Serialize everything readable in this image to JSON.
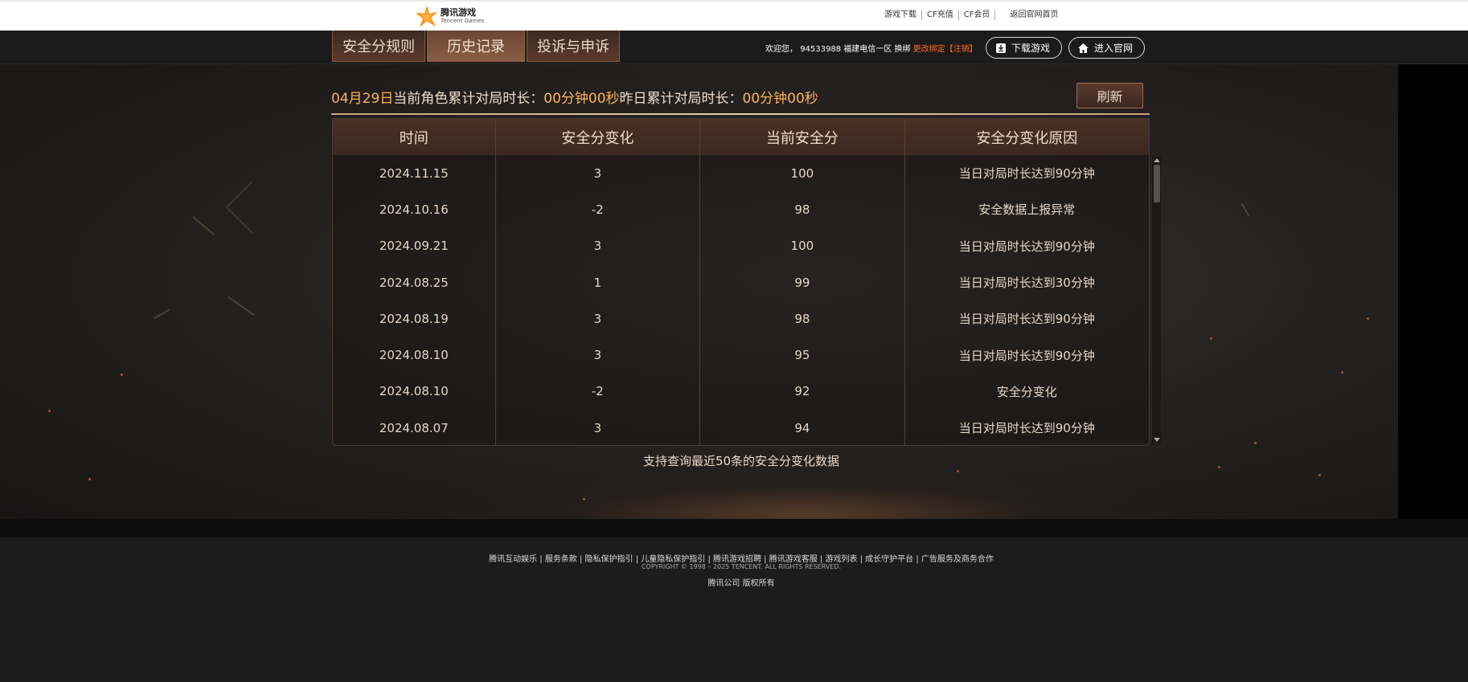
{
  "brand": {
    "logo_cn": "腾讯游戏",
    "logo_en": "Tencent Games",
    "accent": "#ff8a00"
  },
  "top_links": [
    "游戏下载",
    "CF充值",
    "CF会员",
    "返回官网首页"
  ],
  "nav": {
    "tabs": [
      {
        "label": "安全分规则",
        "active": false
      },
      {
        "label": "历史记录",
        "active": true
      },
      {
        "label": "投诉与申诉",
        "active": false
      }
    ],
    "welcome_prefix": "欢迎您，",
    "user_id": "94533988",
    "server": "福建电信一区",
    "switch_label": "换绑",
    "rebind_label": "更改绑定",
    "logout_label": "【注销】",
    "download_label": "下载游戏",
    "home_label": "进入官网"
  },
  "stats": {
    "date": "04月29日",
    "today_label": "当前角色累计对局时长：",
    "today_value": "00分钟00秒",
    "yesterday_label": "昨日累计对局时长：",
    "yesterday_value": "00分钟00秒",
    "refresh_label": "刷新"
  },
  "table": {
    "headers": [
      "时间",
      "安全分变化",
      "当前安全分",
      "安全分变化原因"
    ],
    "rows": [
      [
        "2024.11.15",
        "3",
        "100",
        "当日对局时长达到90分钟"
      ],
      [
        "2024.10.16",
        "-2",
        "98",
        "安全数据上报异常"
      ],
      [
        "2024.09.21",
        "3",
        "100",
        "当日对局时长达到90分钟"
      ],
      [
        "2024.08.25",
        "1",
        "99",
        "当日对局时长达到30分钟"
      ],
      [
        "2024.08.19",
        "3",
        "98",
        "当日对局时长达到90分钟"
      ],
      [
        "2024.08.10",
        "3",
        "95",
        "当日对局时长达到90分钟"
      ],
      [
        "2024.08.10",
        "-2",
        "92",
        "安全分变化"
      ],
      [
        "2024.08.07",
        "3",
        "94",
        "当日对局时长达到90分钟"
      ]
    ],
    "note": "支持查询最近50条的安全分变化数据"
  },
  "footer": {
    "links": "腾讯互动娱乐 | 服务条款 | 隐私保护指引 | 儿童隐私保护指引 | 腾讯游戏招聘 | 腾讯游戏客服 | 游戏列表 | 成长守护平台 | 广告服务及商务合作",
    "copyright": "COPYRIGHT © 1998 – 2025 TENCENT. ALL RIGHTS RESERVED.",
    "corp": "腾讯公司 版权所有"
  }
}
